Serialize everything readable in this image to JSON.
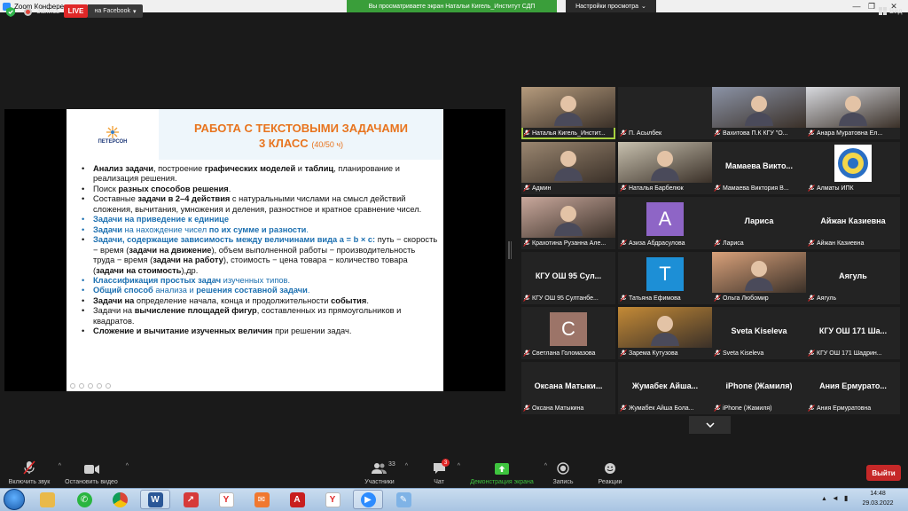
{
  "window": {
    "title": "Zoom Конференция",
    "share_banner": "Вы просматриваете экран Натальи Кигель_Институт СДП",
    "view_options": "Настройки просмотра"
  },
  "topbar": {
    "record_label": "Запись",
    "live_label": "LIVE",
    "live_target": "на Facebook",
    "view_label": "Вид"
  },
  "slide": {
    "logo_text": "ПЕТЕРСОН",
    "title_line1": "РАБОТА С ТЕКСТОВЫМИ ЗАДАЧАМИ",
    "title_line2": "3 КЛАСС",
    "title_hours": "(40/50 ч)",
    "items": [
      {
        "blue": false,
        "parts": [
          {
            "t": "Анализ задачи",
            "b": true
          },
          {
            "t": ", построение "
          },
          {
            "t": "графических моделей",
            "b": true
          },
          {
            "t": " и "
          },
          {
            "t": "таблиц",
            "b": true
          },
          {
            "t": ", планирование и реализация решения."
          }
        ]
      },
      {
        "blue": false,
        "parts": [
          {
            "t": "Поиск "
          },
          {
            "t": "разных способов решения",
            "b": true
          },
          {
            "t": "."
          }
        ]
      },
      {
        "blue": false,
        "parts": [
          {
            "t": "Составные "
          },
          {
            "t": "задачи в 2–4 действия",
            "b": true
          },
          {
            "t": " с натуральными числами на смысл действий сложения, вычитания, умножения и деления, разностное и кратное сравнение чисел."
          }
        ]
      },
      {
        "blue": true,
        "parts": [
          {
            "t": "Задачи на приведение к единице",
            "b": true
          }
        ]
      },
      {
        "blue": true,
        "parts": [
          {
            "t": "Задачи",
            "b": true
          },
          {
            "t": " на нахождение чисел "
          },
          {
            "t": "по их сумме и разности",
            "b": true
          },
          {
            "t": "."
          }
        ]
      },
      {
        "blue": false,
        "parts": [
          {
            "t": "Задачи, содержащие зависимость между величинами вида a = b × c:",
            "h": true
          },
          {
            "t": " путь − скорость − время ("
          },
          {
            "t": "задачи на движение",
            "b": true
          },
          {
            "t": "), объем выполненной работы − производительность труда − время ("
          },
          {
            "t": "задачи на работу",
            "b": true
          },
          {
            "t": "), стоимость − цена товара − количество товара ("
          },
          {
            "t": "задачи на стоимость",
            "b": true
          },
          {
            "t": "),др."
          }
        ]
      },
      {
        "blue": true,
        "parts": [
          {
            "t": "Классификация простых задач",
            "b": true
          },
          {
            "t": " изученных типов."
          }
        ]
      },
      {
        "blue": true,
        "parts": [
          {
            "t": "Общий способ",
            "b": true
          },
          {
            "t": " анализа и "
          },
          {
            "t": "решения составной задачи",
            "b": true
          },
          {
            "t": "."
          }
        ]
      },
      {
        "blue": false,
        "parts": [
          {
            "t": "Задачи на",
            "b": true
          },
          {
            "t": " определение начала, конца и продолжительности "
          },
          {
            "t": "события",
            "b": true
          },
          {
            "t": "."
          }
        ]
      },
      {
        "blue": false,
        "parts": [
          {
            "t": "Задачи на "
          },
          {
            "t": "вычисление площадей фигур",
            "b": true
          },
          {
            "t": ", составленных из прямоугольников и квадратов."
          }
        ]
      },
      {
        "blue": false,
        "parts": [
          {
            "t": "Сложение и вычитание изученных величин",
            "b": true
          },
          {
            "t": " при решении задач."
          }
        ]
      }
    ]
  },
  "gallery": [
    {
      "label": "Наталья Кигель_Инстит...",
      "kind": "photo",
      "bg": "#b59b7d",
      "active": true
    },
    {
      "label": "П. Асылбек",
      "kind": "blank"
    },
    {
      "label": "Вахитова П.К КГУ \"О...",
      "kind": "photo",
      "bg": "#8b93a6"
    },
    {
      "label": "Анара Муратовна Ел...",
      "kind": "photo",
      "bg": "#d7d9de"
    },
    {
      "label": "Админ",
      "kind": "photo",
      "bg": "#9a8670"
    },
    {
      "label": "Наталья Барбелюк",
      "kind": "photo",
      "bg": "#c7c0ae"
    },
    {
      "label": "Мамаева Виктория В...",
      "kind": "name",
      "big": "Мамаева Викто..."
    },
    {
      "label": "Алматы ИПК",
      "kind": "logo"
    },
    {
      "label": "Крахотина Рузанна Але...",
      "kind": "photo",
      "bg": "#c9a89c"
    },
    {
      "label": "Азиза Абдрасулова",
      "kind": "avatar",
      "letter": "A",
      "color": "#8e65c6"
    },
    {
      "label": "Лариса",
      "kind": "name",
      "big": "Лариса"
    },
    {
      "label": "Айжан Казиевна",
      "kind": "name",
      "big": "Айжан Казиевна"
    },
    {
      "label": "КГУ ОШ 95 Султанбе...",
      "kind": "name",
      "big": "КГУ ОШ 95 Сул..."
    },
    {
      "label": "Татьяна Ефимова",
      "kind": "avatar",
      "letter": "T",
      "color": "#1d8fd6"
    },
    {
      "label": "Ольга Любомир",
      "kind": "photo",
      "bg": "#d9a17a"
    },
    {
      "label": "Аягуль",
      "kind": "name",
      "big": "Аягуль"
    },
    {
      "label": "Светлана Голомазова",
      "kind": "avatar",
      "letter": "C",
      "color": "#9c7468"
    },
    {
      "label": "Зарема Кутузова",
      "kind": "photo",
      "bg": "#c48a36"
    },
    {
      "label": "Sveta Kiseleva",
      "kind": "name",
      "big": "Sveta Kiseleva"
    },
    {
      "label": "КГУ ОШ 171 Шадрин...",
      "kind": "name",
      "big": "КГУ ОШ 171 Ша..."
    },
    {
      "label": "Оксана Матыкина",
      "kind": "name",
      "big": "Оксана Матыки..."
    },
    {
      "label": "Жумабек Айша Бола...",
      "kind": "name",
      "big": "Жумабек Айша..."
    },
    {
      "label": "iPhone (Жамиля)",
      "kind": "name",
      "big": "iPhone (Жамиля)"
    },
    {
      "label": "Ания Ермуратовна",
      "kind": "name",
      "big": "Ания Ермурато..."
    }
  ],
  "toolbar": {
    "unmute_label": "Включить звук",
    "video_label": "Остановить видео",
    "participants_label": "Участники",
    "participants_count": "33",
    "chat_label": "Чат",
    "chat_badge": "3",
    "share_label": "Демонстрация экрана",
    "record_label": "Запись",
    "reactions_label": "Реакции",
    "leave_label": "Выйти"
  },
  "taskbar": {
    "time": "14:48",
    "date": "29.03.2022"
  },
  "colors": {
    "accent_green": "#3ec43e",
    "live_red": "#e02828",
    "leave_red": "#c62828",
    "slide_title": "#e8741e",
    "slide_blue": "#1b6fb0"
  }
}
